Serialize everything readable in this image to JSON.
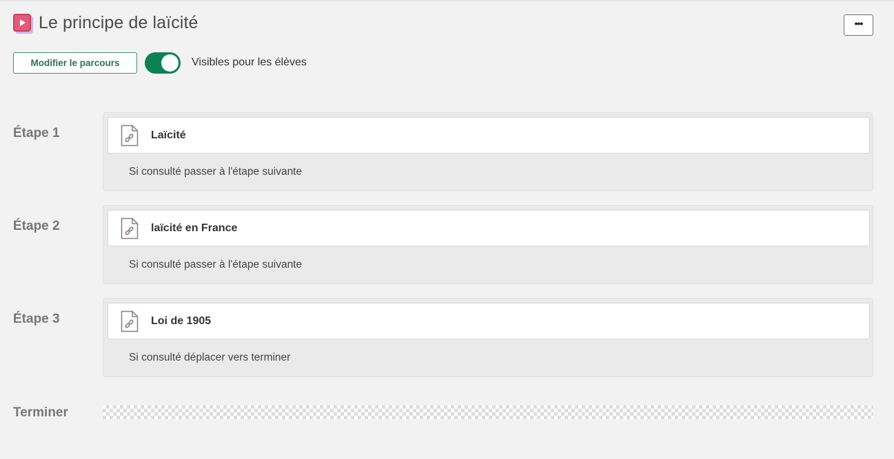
{
  "header": {
    "title": "Le principe de laïcité",
    "icon": "play-icon",
    "accent": "#e05c7a"
  },
  "toolbar": {
    "more_label": "•••",
    "edit_label": "Modifier le parcours",
    "visible_toggle": {
      "on": true,
      "label": "Visibles pour les élèves",
      "color": "#0c8156"
    }
  },
  "steps": [
    {
      "label": "Étape 1",
      "resource": {
        "title": "Laïcité",
        "icon": "link-file-icon"
      },
      "condition": "Si consulté passer à l'étape suivante"
    },
    {
      "label": "Étape 2",
      "resource": {
        "title": "laïcité en France",
        "icon": "link-file-icon"
      },
      "condition": "Si consulté passer à l'étape suivante"
    },
    {
      "label": "Étape 3",
      "resource": {
        "title": "Loi de 1905",
        "icon": "link-file-icon"
      },
      "condition": "Si consulté déplacer vers terminer"
    }
  ],
  "end": {
    "label": "Terminer"
  }
}
